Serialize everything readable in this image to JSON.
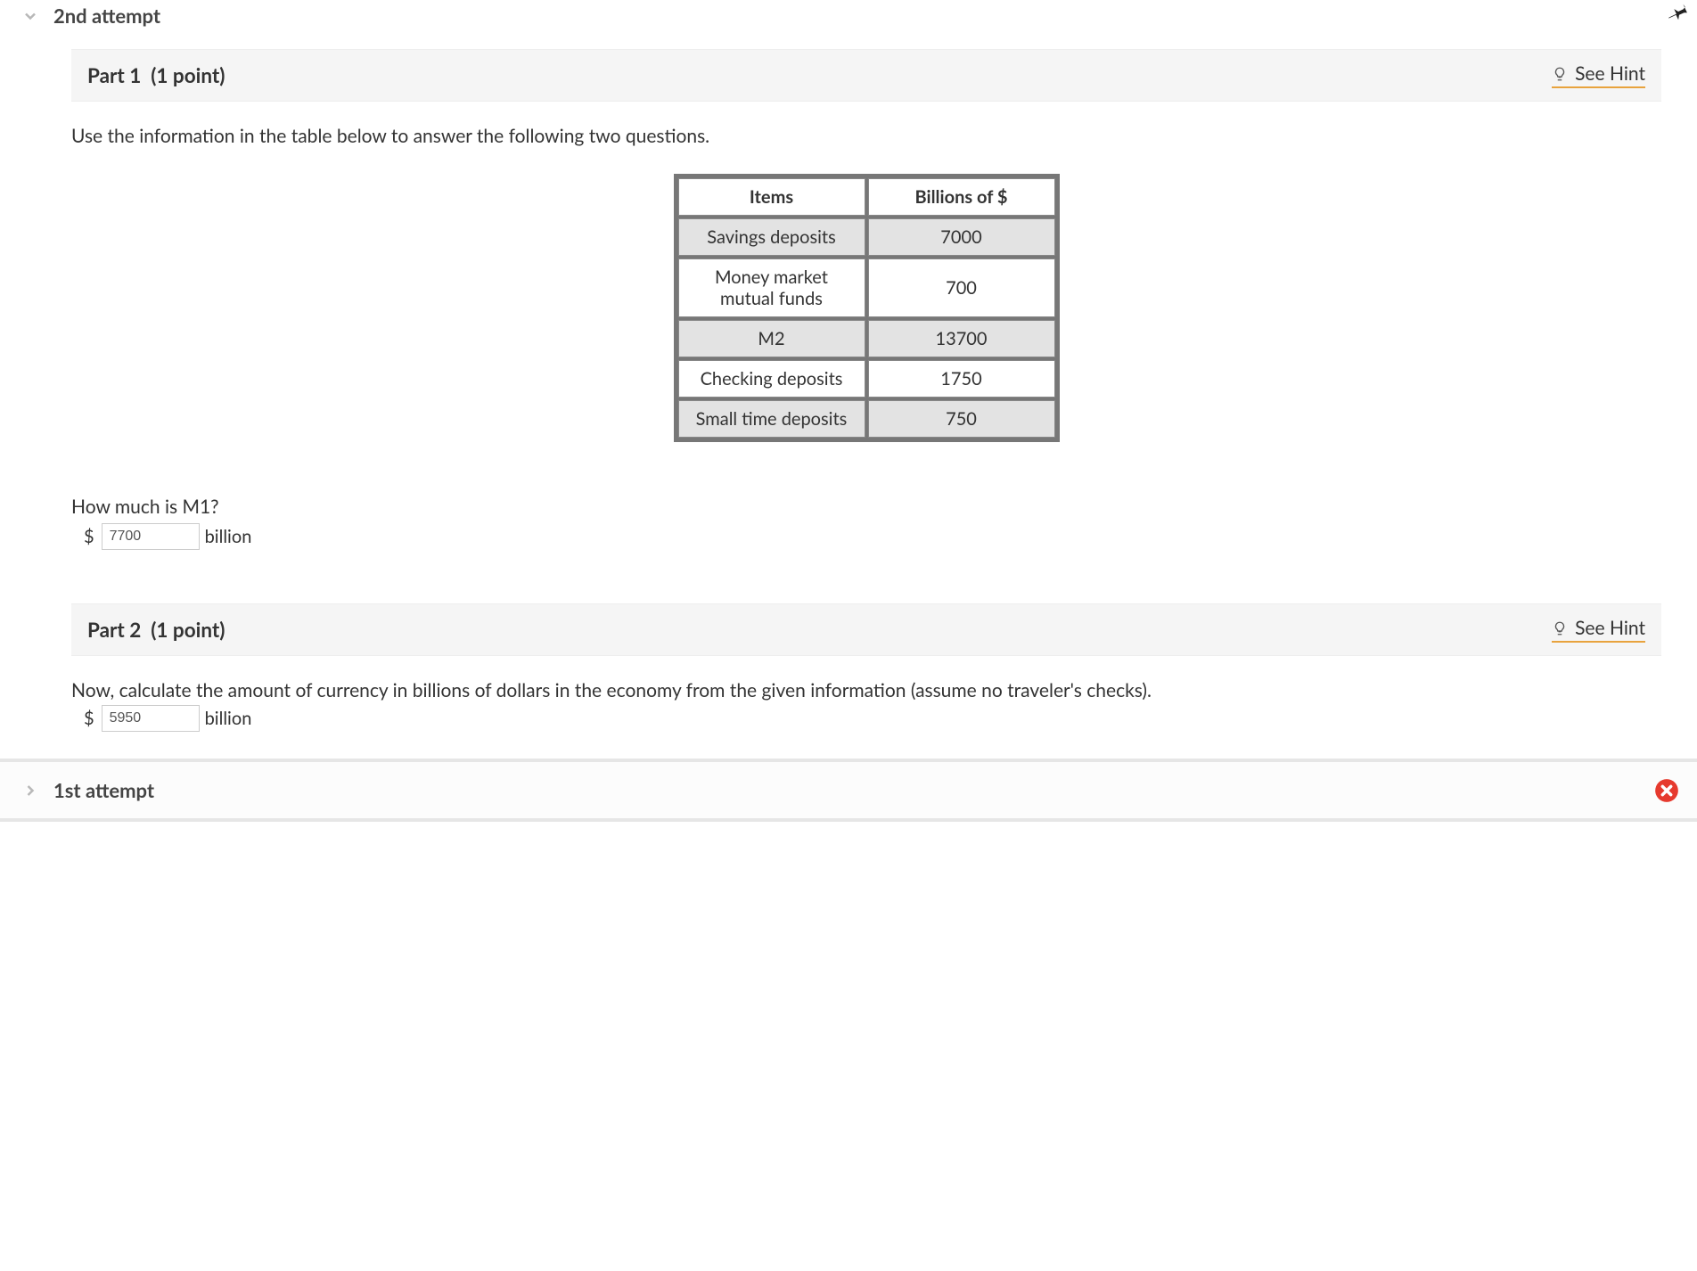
{
  "attempts": {
    "current_label": "2nd attempt",
    "previous_label": "1st attempt"
  },
  "hint_label": "See Hint",
  "part1": {
    "title": "Part 1",
    "points": "(1 point)",
    "prompt": "Use the information in the table below to answer the following two questions.",
    "table": {
      "header_items": "Items",
      "header_values": "Billions of $",
      "rows": [
        {
          "label": "Savings deposits",
          "value": "7000",
          "shaded": true
        },
        {
          "label": "Money market mutual funds",
          "value": "700",
          "shaded": false
        },
        {
          "label": "M2",
          "value": "13700",
          "shaded": true
        },
        {
          "label": "Checking deposits",
          "value": "1750",
          "shaded": false
        },
        {
          "label": "Small time deposits",
          "value": "750",
          "shaded": true
        }
      ]
    },
    "question": "How much is M1?",
    "currency_symbol": "$",
    "answer_value": "7700",
    "unit": "billion"
  },
  "part2": {
    "title": "Part 2",
    "points": "(1 point)",
    "prompt": "Now, calculate the amount of currency in billions of dollars in the economy from the given information (assume no traveler's checks).",
    "currency_symbol": "$",
    "answer_value": "5950",
    "unit": "billion"
  },
  "chart_data": {
    "type": "table",
    "title": "Money supply components",
    "columns": [
      "Items",
      "Billions of $"
    ],
    "rows": [
      [
        "Savings deposits",
        7000
      ],
      [
        "Money market mutual funds",
        700
      ],
      [
        "M2",
        13700
      ],
      [
        "Checking deposits",
        1750
      ],
      [
        "Small time deposits",
        750
      ]
    ]
  },
  "icons": {
    "chevron_down": "chevron-down-icon",
    "chevron_right": "chevron-right-icon",
    "lightbulb": "lightbulb-icon",
    "pin": "pin-icon",
    "error": "error-icon"
  }
}
